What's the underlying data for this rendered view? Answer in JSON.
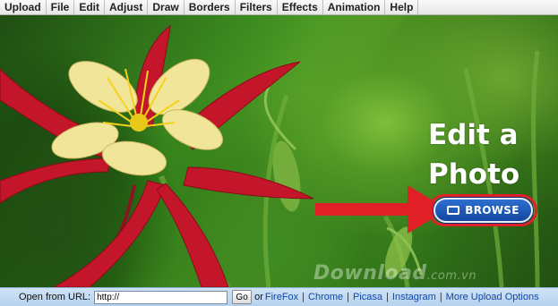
{
  "menu": {
    "items": [
      {
        "label": "Upload"
      },
      {
        "label": "File"
      },
      {
        "label": "Edit"
      },
      {
        "label": "Adjust"
      },
      {
        "label": "Draw"
      },
      {
        "label": "Borders"
      },
      {
        "label": "Filters"
      },
      {
        "label": "Effects"
      },
      {
        "label": "Animation"
      },
      {
        "label": "Help"
      }
    ]
  },
  "hero": {
    "title_line1": "Edit a",
    "title_line2": "Photo",
    "browse_label": "BROWSE",
    "watermark": "Download",
    "watermark_suffix": ".com.vn"
  },
  "colors": {
    "menu_text": "#222222",
    "arrow": "#e01f26",
    "browse_bg": "#1f5bb8",
    "urlbar_bg": "#c3dbf3",
    "link": "#1046a8"
  },
  "url_bar": {
    "label": "Open from URL:",
    "input_value": "http://",
    "go_label": "Go",
    "or_text": "or",
    "links": [
      "FireFox",
      "Chrome",
      "Picasa",
      "Instagram",
      "More Upload Options"
    ]
  }
}
